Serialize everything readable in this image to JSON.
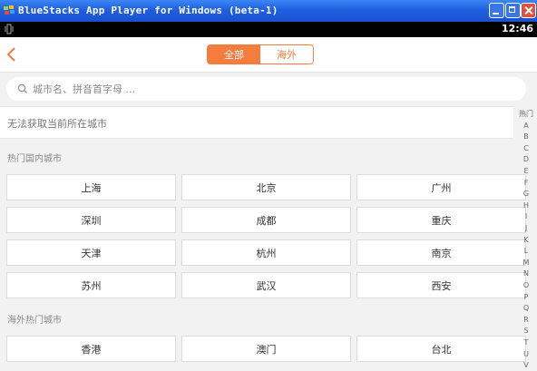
{
  "window": {
    "title": "BlueStacks App Player for Windows (beta-1)"
  },
  "statusbar": {
    "time": "12:46"
  },
  "header": {
    "tabs": [
      {
        "label": "全部",
        "active": true
      },
      {
        "label": "海外",
        "active": false
      }
    ]
  },
  "search": {
    "placeholder": "城市名、拼音首字母 ..."
  },
  "location": {
    "text": "无法获取当前所在城市"
  },
  "hot_domestic": {
    "label": "热门国内城市",
    "cities": [
      "上海",
      "北京",
      "广州",
      "深圳",
      "成都",
      "重庆",
      "天津",
      "杭州",
      "南京",
      "苏州",
      "武汉",
      "西安"
    ]
  },
  "hot_overseas": {
    "label": "海外热门城市",
    "cities": [
      "香港",
      "澳门",
      "台北"
    ]
  },
  "index_bar": [
    "热门",
    "A",
    "B",
    "C",
    "D",
    "E",
    "F",
    "G",
    "H",
    "I",
    "J",
    "K",
    "L",
    "M",
    "N",
    "O",
    "P",
    "Q",
    "R",
    "S",
    "T",
    "U",
    "V"
  ],
  "colors": {
    "accent": "#f47c3c",
    "background": "#f2f2f2"
  }
}
